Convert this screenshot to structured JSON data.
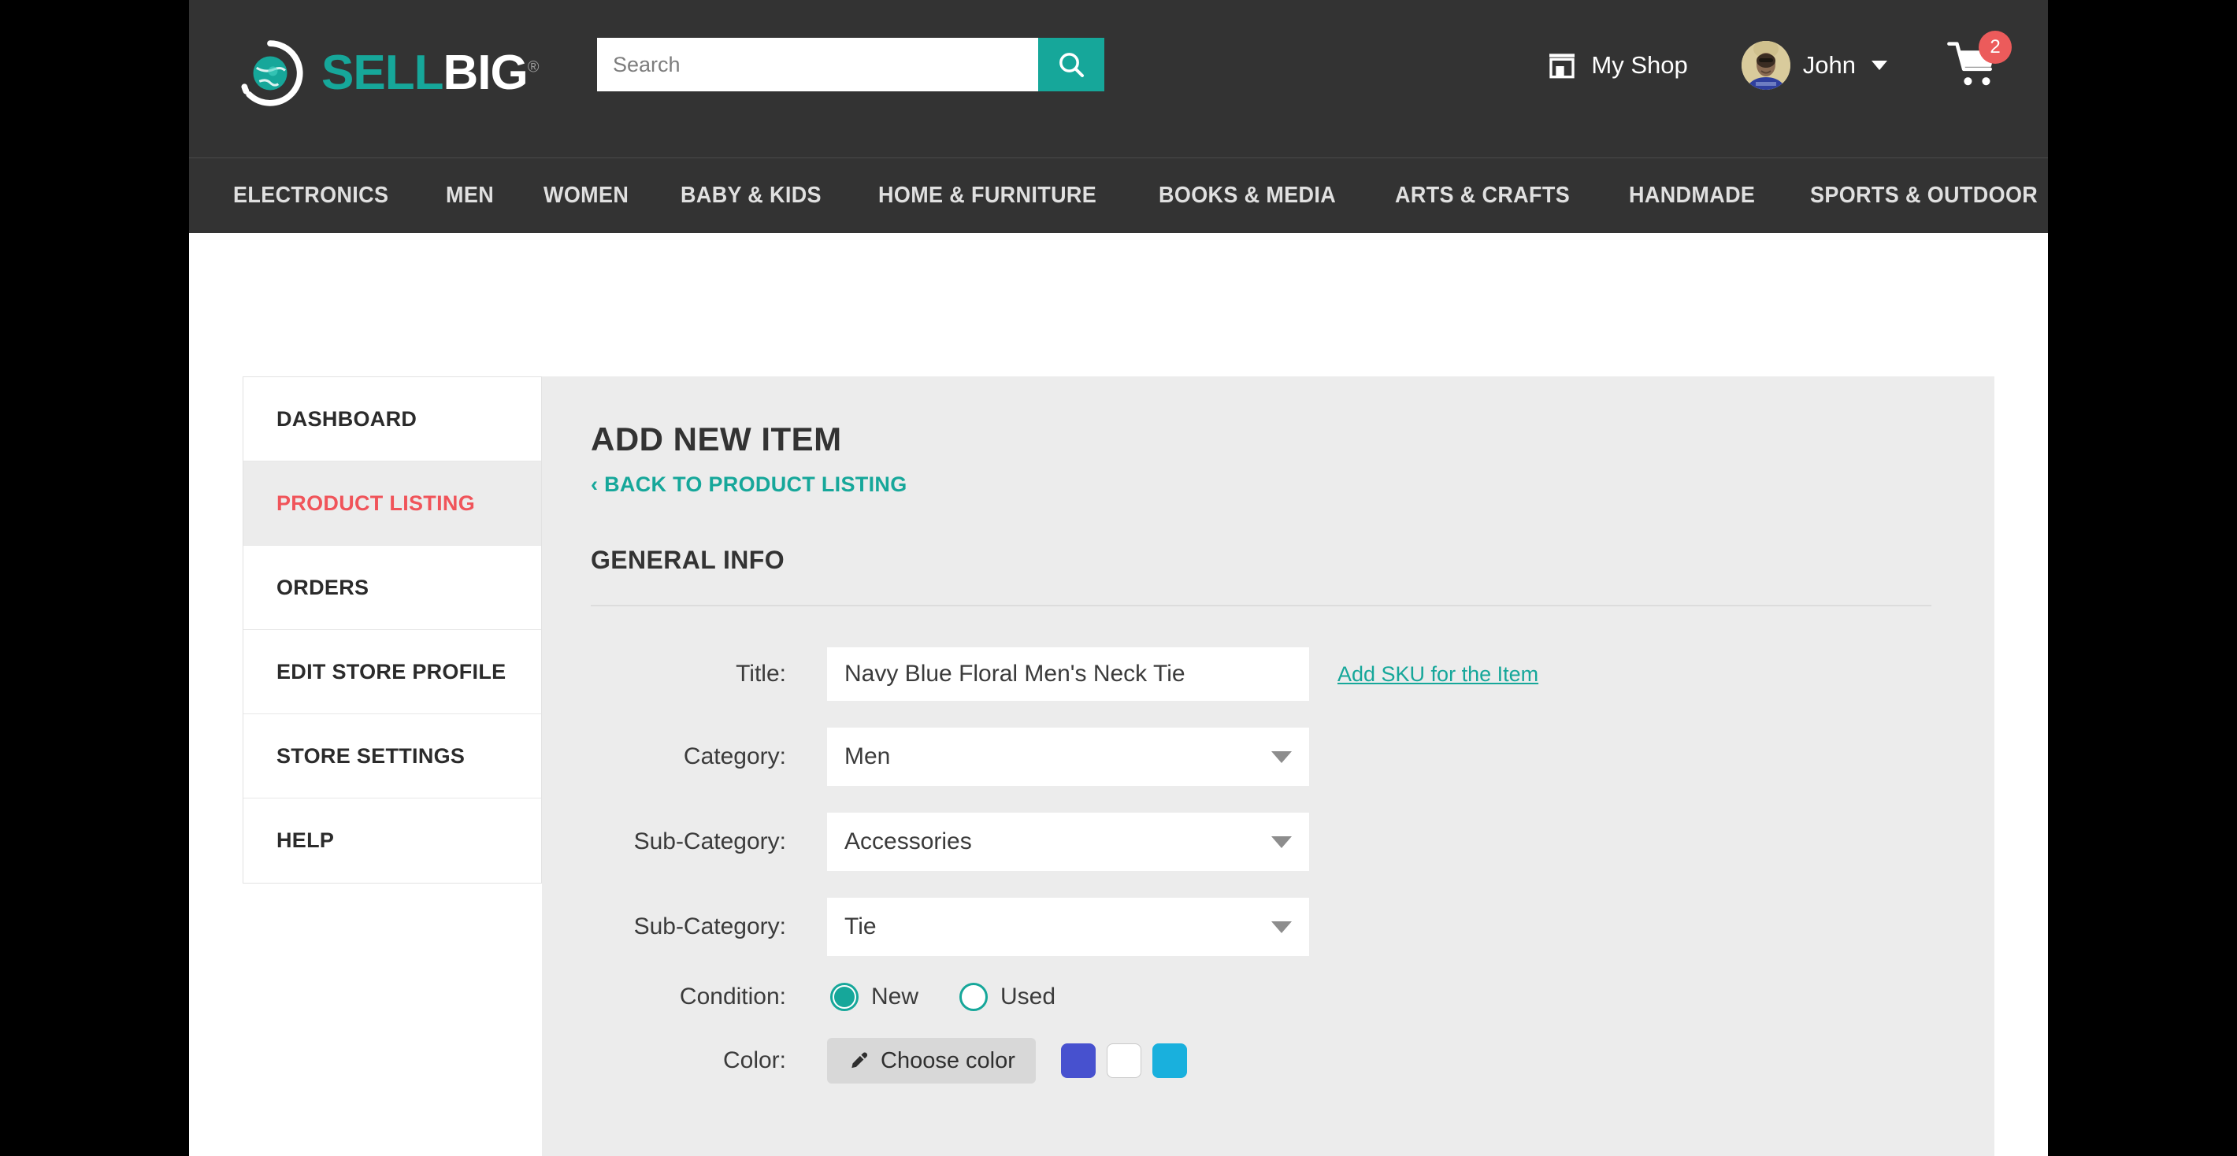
{
  "brand": {
    "name_part1": "SELL",
    "name_part2": "BIG",
    "registered_mark": "®",
    "teal": "#16a79a",
    "header_bg": "#333333",
    "accent_red": "#f0545a",
    "badge_red": "#ec5b5b",
    "panel_bg": "#ececec"
  },
  "header": {
    "search": {
      "placeholder": "Search",
      "value": "",
      "icon": "search-icon"
    },
    "my_shop_label": "My Shop",
    "my_shop_icon": "store-icon",
    "user_name": "John",
    "user_caret": "chevron-down-icon",
    "avatar_icon": "user-avatar",
    "cart_icon": "shopping-cart-icon",
    "cart_count": "2"
  },
  "nav": {
    "items": [
      {
        "label": "ELECTRONICS"
      },
      {
        "label": "MEN"
      },
      {
        "label": "WOMEN"
      },
      {
        "label": "BABY & KIDS"
      },
      {
        "label": "HOME & FURNITURE"
      },
      {
        "label": "BOOKS & MEDIA"
      },
      {
        "label": "ARTS & CRAFTS"
      },
      {
        "label": "HANDMADE"
      },
      {
        "label": "SPORTS & OUTDOOR"
      }
    ]
  },
  "sidebar": {
    "items": [
      {
        "label": "DASHBOARD",
        "active": false
      },
      {
        "label": "PRODUCT LISTING",
        "active": true
      },
      {
        "label": "ORDERS",
        "active": false
      },
      {
        "label": "EDIT STORE PROFILE",
        "active": false
      },
      {
        "label": "STORE SETTINGS",
        "active": false
      },
      {
        "label": "HELP",
        "active": false
      }
    ]
  },
  "main": {
    "page_title": "ADD NEW ITEM",
    "back_link": "‹ BACK TO PRODUCT LISTING",
    "section_title": "GENERAL INFO",
    "fields": {
      "title": {
        "label": "Title:",
        "value": "Navy Blue Floral Men's Neck Tie",
        "placeholder": "",
        "side_link": "Add SKU for the Item"
      },
      "category": {
        "label": "Category:",
        "value": "Men"
      },
      "sub_category_1": {
        "label": "Sub-Category:",
        "value": "Accessories"
      },
      "sub_category_2": {
        "label": "Sub-Category:",
        "value": "Tie"
      },
      "condition": {
        "label": "Condition:",
        "options": [
          {
            "label": "New",
            "selected": true
          },
          {
            "label": "Used",
            "selected": false
          }
        ]
      },
      "color": {
        "label": "Color:",
        "button_label": "Choose color",
        "button_icon": "eyedropper-icon",
        "swatches": [
          {
            "name": "indigo",
            "hex": "#4751cf"
          },
          {
            "name": "white",
            "hex": "#ffffff"
          },
          {
            "name": "cyan",
            "hex": "#19b0dd"
          }
        ]
      }
    }
  }
}
